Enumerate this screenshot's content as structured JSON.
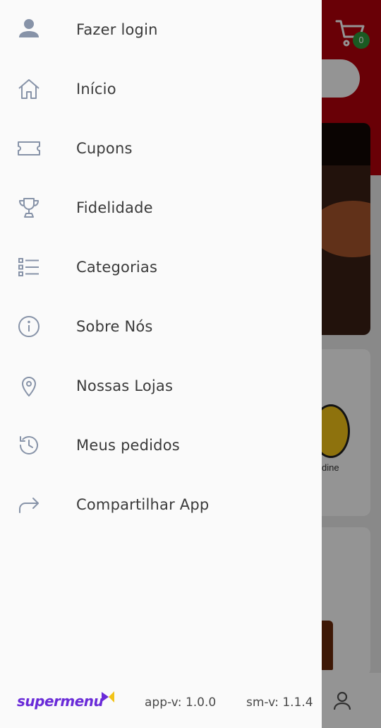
{
  "app": {
    "cart_count": "0",
    "background_store_text": "dine",
    "colors": {
      "header": "#b5000b",
      "cart_badge": "#2e9c3c",
      "brand": "#6a2bd8",
      "brand_accent": "#f2c318",
      "icon": "#8793a8"
    }
  },
  "drawer": {
    "items": [
      {
        "label": "Fazer login",
        "icon": "person-icon"
      },
      {
        "label": "Início",
        "icon": "home-icon"
      },
      {
        "label": "Cupons",
        "icon": "ticket-icon"
      },
      {
        "label": "Fidelidade",
        "icon": "trophy-icon"
      },
      {
        "label": "Categorias",
        "icon": "list-icon"
      },
      {
        "label": "Sobre Nós",
        "icon": "info-icon"
      },
      {
        "label": "Nossas Lojas",
        "icon": "location-pin-icon"
      },
      {
        "label": "Meus pedidos",
        "icon": "history-icon"
      },
      {
        "label": "Compartilhar App",
        "icon": "share-icon"
      }
    ],
    "footer": {
      "brand": "supermenu",
      "app_version": "app-v: 1.0.0",
      "sm_version": "sm-v: 1.1.4"
    }
  }
}
